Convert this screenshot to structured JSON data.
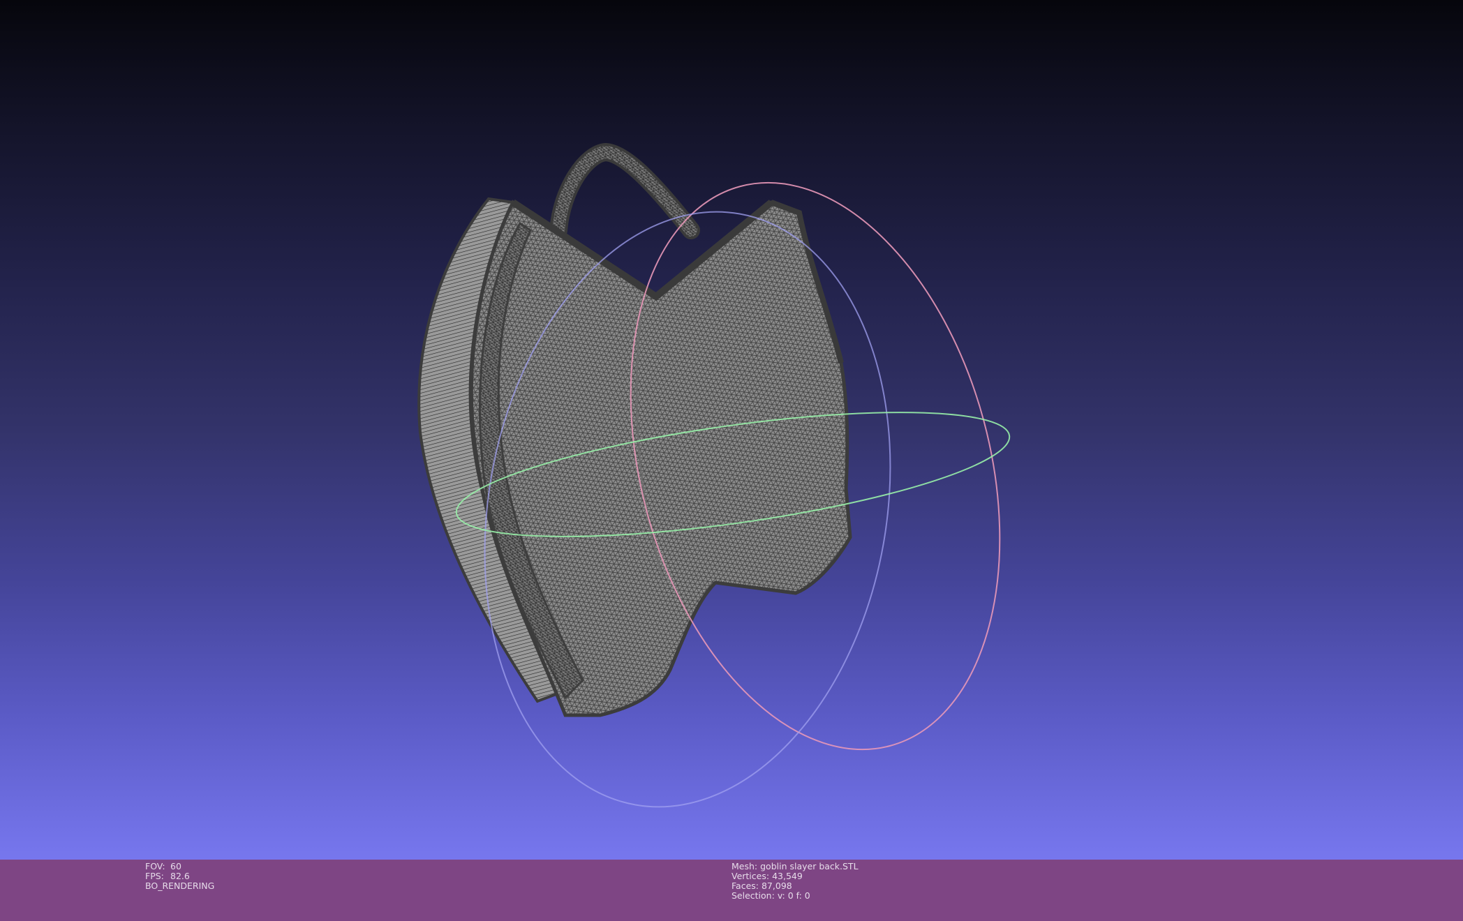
{
  "viewport": {
    "gradient_top": "#06060c",
    "gradient_bottom": "#7777ee",
    "model_color": "#8e8e8e",
    "wire_color": "#3c3c3c",
    "trackball_colors": {
      "x_ring": "#e898b8",
      "y_ring": "#98f0a8",
      "z_ring": "#a0a0f0"
    }
  },
  "status": {
    "bar_color": "#7e4584",
    "left": {
      "fov_label": "FOV:",
      "fov_value": "60",
      "fps_label": "FPS:",
      "fps_value": "82.6",
      "mode": "BO_RENDERING"
    },
    "center": {
      "mesh_label": "Mesh:",
      "mesh_value": "goblin slayer back.STL",
      "vertices_label": "Vertices:",
      "vertices_value": "43,549",
      "faces_label": "Faces:",
      "faces_value": "87,098",
      "selection_label": "Selection:",
      "selection_value": "v: 0 f: 0"
    }
  }
}
